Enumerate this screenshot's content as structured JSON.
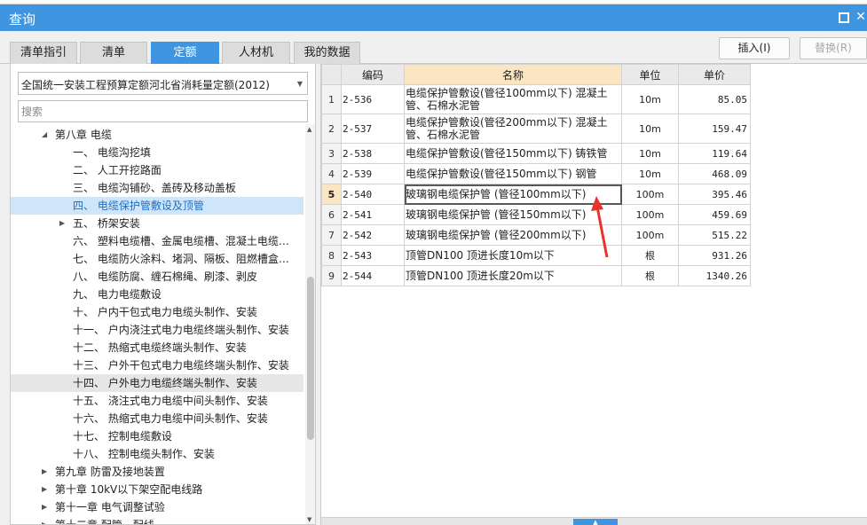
{
  "window": {
    "title": "查询"
  },
  "tabs": [
    "清单指引",
    "清单",
    "定额",
    "人材机",
    "我的数据"
  ],
  "buttons": {
    "insert": "插入(I)",
    "replace": "替换(R)"
  },
  "left": {
    "library": "全国统一安装工程预算定额河北省消耗量定额(2012)",
    "search_placeholder": "搜索",
    "tree": [
      {
        "label": "第八章 电缆",
        "toggle": "◢"
      },
      {
        "label": "一、 电缆沟挖填"
      },
      {
        "label": "二、 人工开挖路面"
      },
      {
        "label": "三、 电缆沟铺砂、盖砖及移动盖板"
      },
      {
        "label": "四、 电缆保护管敷设及顶管"
      },
      {
        "label": "五、 桥架安装",
        "toggle": "▶"
      },
      {
        "label": "六、 塑料电缆槽、金属电缆槽、混凝土电缆…"
      },
      {
        "label": "七、 电缆防火涂料、堵洞、隔板、阻燃槽盒…"
      },
      {
        "label": "八、 电缆防腐、缠石棉绳、刷漆、剥皮"
      },
      {
        "label": "九、 电力电缆敷设"
      },
      {
        "label": "十、 户内干包式电力电缆头制作、安装"
      },
      {
        "label": "十一、 户内浇注式电力电缆终端头制作、安装"
      },
      {
        "label": "十二、 热缩式电缆终端头制作、安装"
      },
      {
        "label": "十三、 户外干包式电力电缆终端头制作、安装"
      },
      {
        "label": "十四、 户外电力电缆终端头制作、安装"
      },
      {
        "label": "十五、 浇注式电力电缆中间头制作、安装"
      },
      {
        "label": "十六、 热缩式电力电缆中间头制作、安装"
      },
      {
        "label": "十七、 控制电缆敷设"
      },
      {
        "label": "十八、 控制电缆头制作、安装"
      },
      {
        "label": "第九章 防雷及接地装置",
        "toggle": "▶"
      },
      {
        "label": "第十章 10kV以下架空配电线路",
        "toggle": "▶"
      },
      {
        "label": "第十一章 电气调整试验",
        "toggle": "▶"
      },
      {
        "label": "第十二章 配管、配线",
        "toggle": "▶"
      }
    ]
  },
  "grid": {
    "headers": [
      "",
      "编码",
      "名称",
      "单位",
      "单价"
    ],
    "rows": [
      {
        "n": "1",
        "code": "2-536",
        "name": "电缆保护管敷设(管径100mm以下) 混凝土管、石棉水泥管",
        "unit": "10m",
        "price": "85.05"
      },
      {
        "n": "2",
        "code": "2-537",
        "name": "电缆保护管敷设(管径200mm以下) 混凝土管、石棉水泥管",
        "unit": "10m",
        "price": "159.47"
      },
      {
        "n": "3",
        "code": "2-538",
        "name": "电缆保护管敷设(管径150mm以下) 铸铁管",
        "unit": "10m",
        "price": "119.64"
      },
      {
        "n": "4",
        "code": "2-539",
        "name": "电缆保护管敷设(管径150mm以下) 钢管",
        "unit": "10m",
        "price": "468.09"
      },
      {
        "n": "5",
        "code": "2-540",
        "name": "玻璃钢电缆保护管 (管径100mm以下)",
        "unit": "100m",
        "price": "395.46"
      },
      {
        "n": "6",
        "code": "2-541",
        "name": "玻璃钢电缆保护管 (管径150mm以下)",
        "unit": "100m",
        "price": "459.69"
      },
      {
        "n": "7",
        "code": "2-542",
        "name": "玻璃钢电缆保护管 (管径200mm以下)",
        "unit": "100m",
        "price": "515.22"
      },
      {
        "n": "8",
        "code": "2-543",
        "name": "顶管DN100 顶进长度10m以下",
        "unit": "根",
        "price": "931.26"
      },
      {
        "n": "9",
        "code": "2-544",
        "name": "顶管DN100 顶进长度20m以下",
        "unit": "根",
        "price": "1340.26"
      }
    ]
  },
  "colors": {
    "accent": "#3f95df",
    "selection": "#cfe5fa",
    "header_highlight": "#fbe5c2",
    "annotation_arrow": "#e8322e"
  },
  "icons": {
    "maximize": "maximize-icon",
    "close": "close-icon",
    "dropdown": "chevron-down-icon",
    "expand": "expand-triangle-icon",
    "collapse": "collapse-triangle-icon"
  }
}
